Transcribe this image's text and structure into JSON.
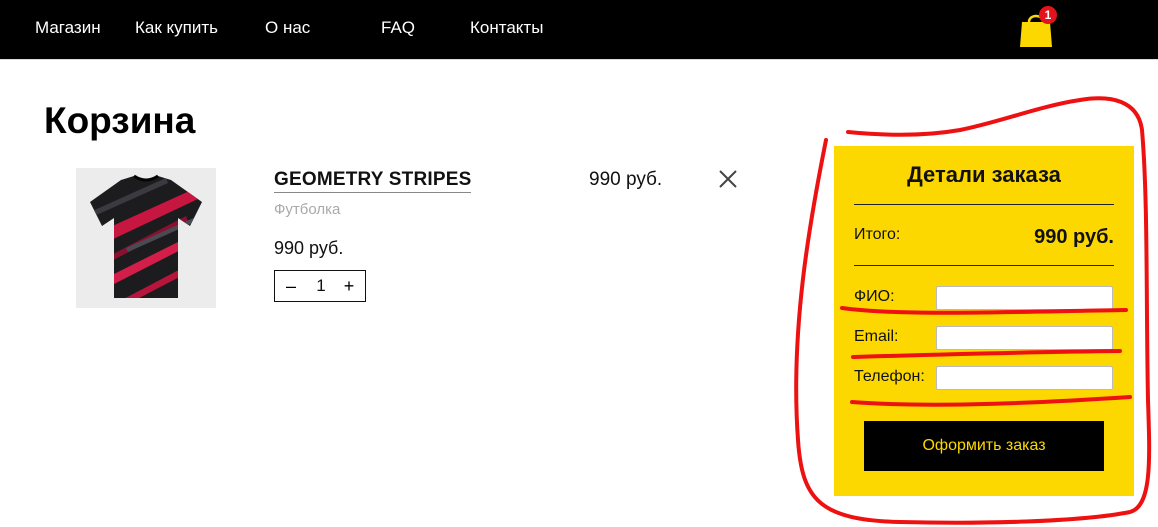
{
  "nav": {
    "items": [
      {
        "label": "Магазин"
      },
      {
        "label": "Как купить"
      },
      {
        "label": "О нас"
      },
      {
        "label": "FAQ"
      },
      {
        "label": "Контакты"
      }
    ],
    "cart_icon": "shopping-bag-icon",
    "cart_count": "1",
    "cart_badge_color": "#e3131b",
    "accent_color": "#fcd700"
  },
  "page": {
    "title": "Корзина"
  },
  "cart_item": {
    "image_icon": "tshirt-image",
    "name": "GEOMETRY STRIPES",
    "type": "Футболка",
    "unit_price": "990 руб.",
    "quantity": "1",
    "decrement": "–",
    "increment": "+",
    "line_price": "990 руб.",
    "remove_icon": "close-icon"
  },
  "order": {
    "title": "Детали заказа",
    "total_label": "Итого:",
    "total_value": "990 руб.",
    "fields": {
      "name_label": "ФИО:",
      "name_value": "",
      "email_label": "Email:",
      "email_value": "",
      "phone_label": "Телефон:",
      "phone_value": ""
    },
    "submit_label": "Оформить заказ"
  }
}
